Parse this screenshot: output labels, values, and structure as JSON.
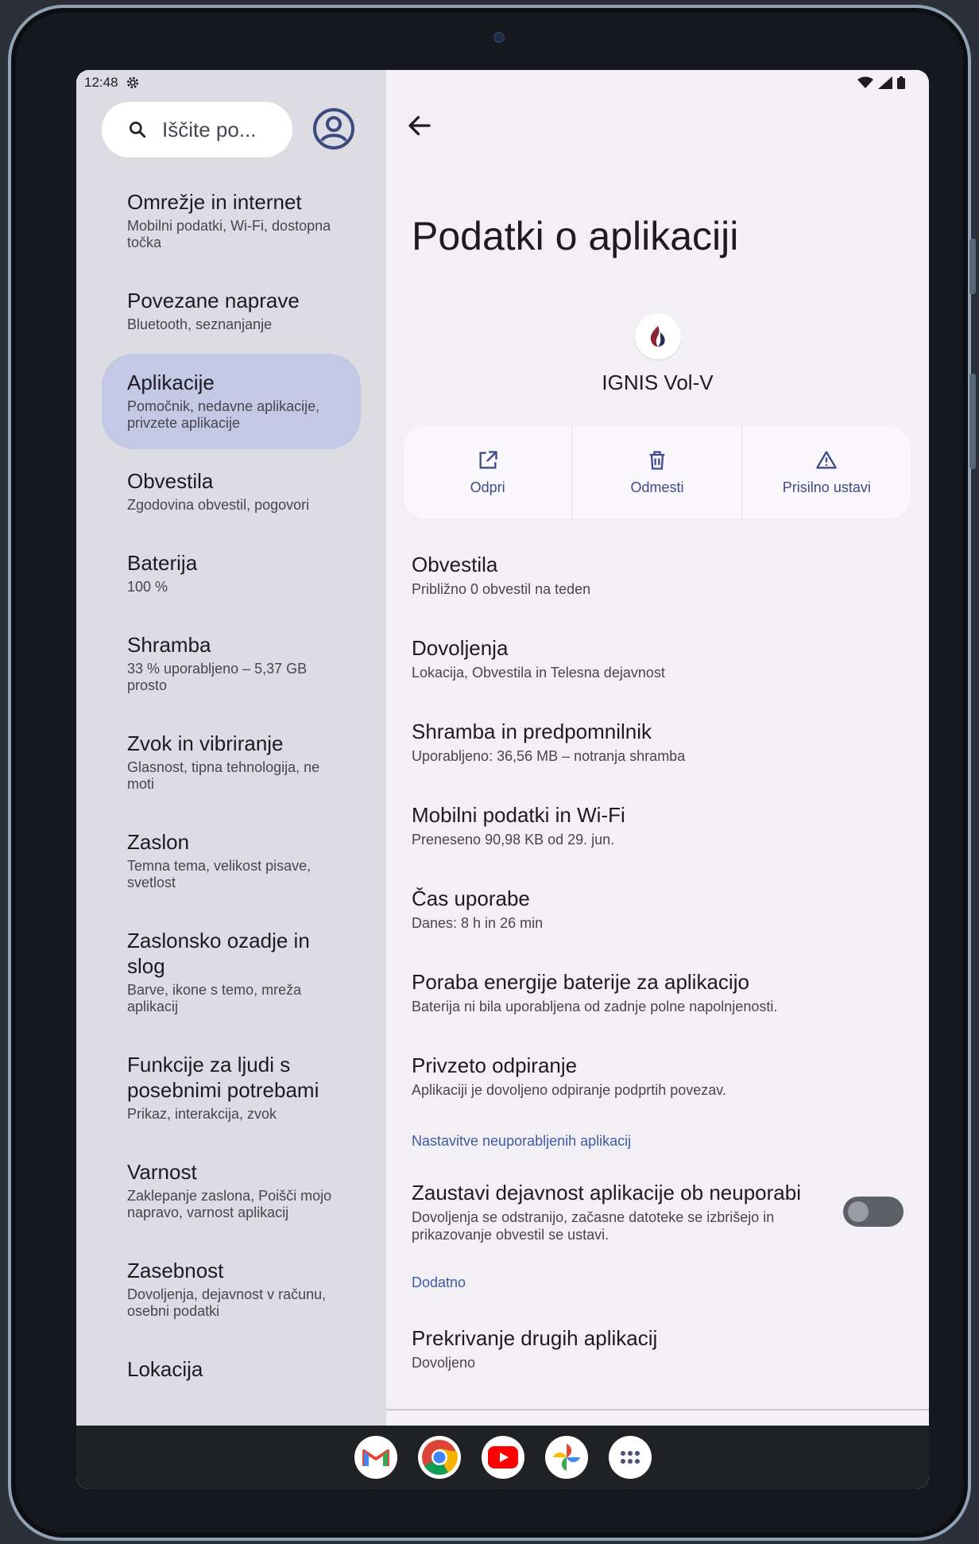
{
  "status": {
    "time": "12:48"
  },
  "search": {
    "placeholder": "Iščite po..."
  },
  "nav": [
    {
      "title": "Omrežje in internet",
      "sub": "Mobilni podatki, Wi-Fi, dostopna točka"
    },
    {
      "title": "Povezane naprave",
      "sub": "Bluetooth, seznanjanje"
    },
    {
      "title": "Aplikacije",
      "sub": "Pomočnik, nedavne aplikacije, privzete aplikacije"
    },
    {
      "title": "Obvestila",
      "sub": "Zgodovina obvestil, pogovori"
    },
    {
      "title": "Baterija",
      "sub": "100 %"
    },
    {
      "title": "Shramba",
      "sub": "33 % uporabljeno – 5,37 GB prosto"
    },
    {
      "title": "Zvok in vibriranje",
      "sub": "Glasnost, tipna tehnologija, ne moti"
    },
    {
      "title": "Zaslon",
      "sub": "Temna tema, velikost pisave, svetlost"
    },
    {
      "title": "Zaslonsko ozadje in slog",
      "sub": "Barve, ikone s temo, mreža aplikacij"
    },
    {
      "title": "Funkcije za ljudi s posebnimi potrebami",
      "sub": "Prikaz, interakcija, zvok"
    },
    {
      "title": "Varnost",
      "sub": "Zaklepanje zaslona, Poišči mojo napravo, varnost aplikacij"
    },
    {
      "title": "Zasebnost",
      "sub": "Dovoljenja, dejavnost v računu, osebni podatki"
    },
    {
      "title": "Lokacija",
      "sub": ""
    }
  ],
  "page": {
    "title": "Podatki o aplikaciji"
  },
  "app": {
    "name": "IGNIS Vol-V"
  },
  "actions": {
    "open": "Odpri",
    "uninstall": "Odmesti",
    "force_stop": "Prisilno ustavi"
  },
  "rows": [
    {
      "title": "Obvestila",
      "sub": "Približno 0 obvestil na teden"
    },
    {
      "title": "Dovoljenja",
      "sub": "Lokacija, Obvestila in Telesna dejavnost"
    },
    {
      "title": "Shramba in predpomnilnik",
      "sub": "Uporabljeno: 36,56 MB – notranja shramba"
    },
    {
      "title": "Mobilni podatki in Wi-Fi",
      "sub": "Preneseno 90,98 KB od 29. jun."
    },
    {
      "title": "Čas uporabe",
      "sub": "Danes: 8 h in 26 min"
    },
    {
      "title": "Poraba energije baterije za aplikacijo",
      "sub": "Baterija ni bila uporabljena od zadnje polne napolnjenosti."
    },
    {
      "title": "Privzeto odpiranje",
      "sub": "Aplikaciji je dovoljeno odpiranje podprtih povezav."
    }
  ],
  "unused": {
    "section": "Nastavitve neuporabljenih aplikacij",
    "title": "Zaustavi dejavnost aplikacije ob neuporabi",
    "sub": "Dovoljenja se odstranijo, začasne datoteke se izbrišejo in prikazovanje obvestil se ustavi.",
    "enabled": false
  },
  "additional": {
    "section": "Dodatno",
    "title": "Prekrivanje drugih aplikacij",
    "sub": "Dovoljeno"
  },
  "taskbar": [
    "gmail-icon",
    "chrome-icon",
    "youtube-icon",
    "photos-icon",
    "app-drawer-icon"
  ],
  "colors": {
    "accent": "#3f5aa7",
    "selected_nav": "#c3c8e4",
    "left_bg": "#dedce3",
    "right_bg": "#f2f0f4"
  }
}
